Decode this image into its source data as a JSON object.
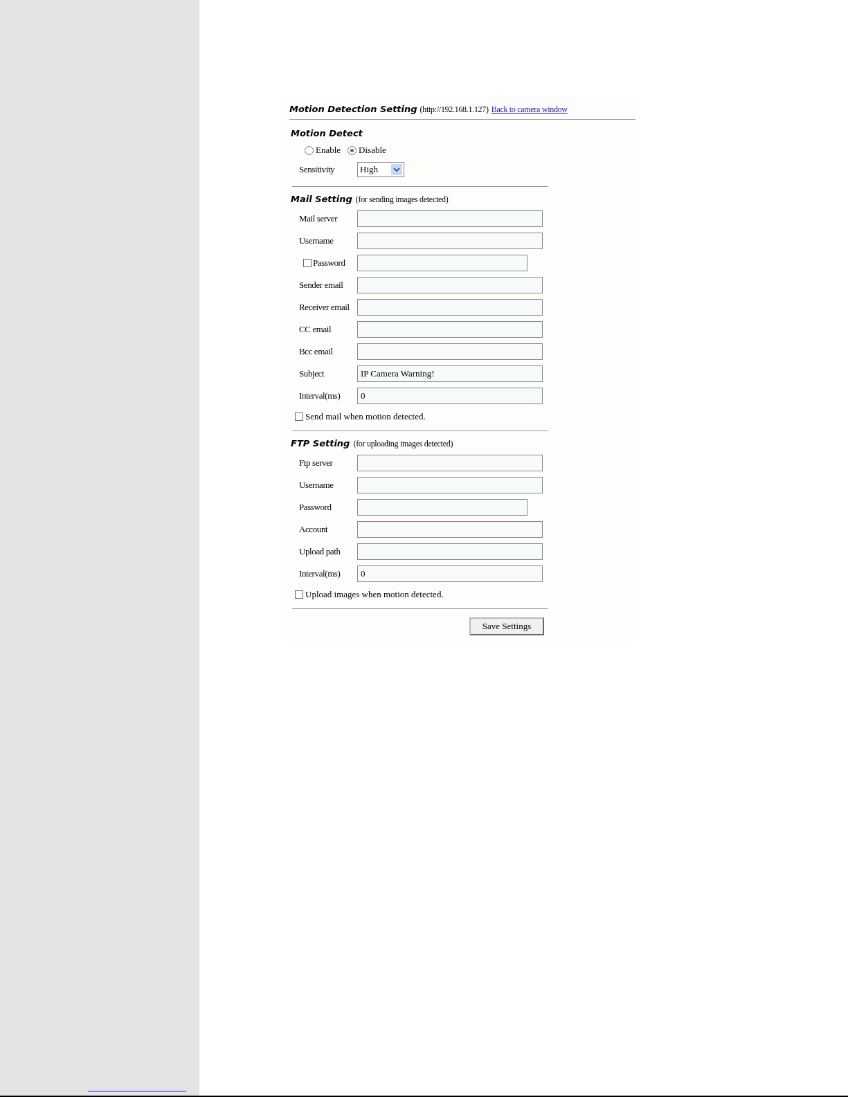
{
  "header": {
    "title": "Motion Detection Setting",
    "address": "(http://192.168.1.127)",
    "link": "Back to camera window"
  },
  "motion_detect": {
    "heading": "Motion Detect",
    "radios": [
      {
        "label": "Enable",
        "selected": false
      },
      {
        "label": "Disable",
        "selected": true
      }
    ],
    "sensitivity": {
      "label": "Sensitivity",
      "value": "High"
    }
  },
  "mail_setting": {
    "heading": "Mail Setting",
    "note": "(for sending images detected)",
    "fields": [
      {
        "kind": "text",
        "label": "Mail server"
      },
      {
        "kind": "text",
        "label": "Username"
      },
      {
        "kind": "check_password",
        "label": "Password",
        "checked": false
      },
      {
        "kind": "text",
        "label": "Sender email"
      },
      {
        "kind": "text",
        "label": "Receiver email"
      },
      {
        "kind": "text",
        "label": "CC email"
      },
      {
        "kind": "text",
        "label": "Bcc email"
      },
      {
        "kind": "text",
        "label": "Subject",
        "value": "IP Camera Warning!"
      },
      {
        "kind": "text",
        "label": "Interval(ms)",
        "value": "0"
      }
    ],
    "option": {
      "label": "Send mail when motion detected.",
      "checked": false
    }
  },
  "ftp_setting": {
    "heading": "FTP Setting",
    "note": "(for uploading images detected)",
    "fields": [
      {
        "kind": "text",
        "label": "Ftp server"
      },
      {
        "kind": "text",
        "label": "Username"
      },
      {
        "kind": "password",
        "label": "Password"
      },
      {
        "kind": "text",
        "label": "Account"
      },
      {
        "kind": "text",
        "label": "Upload path"
      },
      {
        "kind": "text",
        "label": "Interval(ms)",
        "value": "0"
      }
    ],
    "option": {
      "label": "Upload images when motion detected.",
      "checked": false
    }
  },
  "save_button": "Save Settings"
}
